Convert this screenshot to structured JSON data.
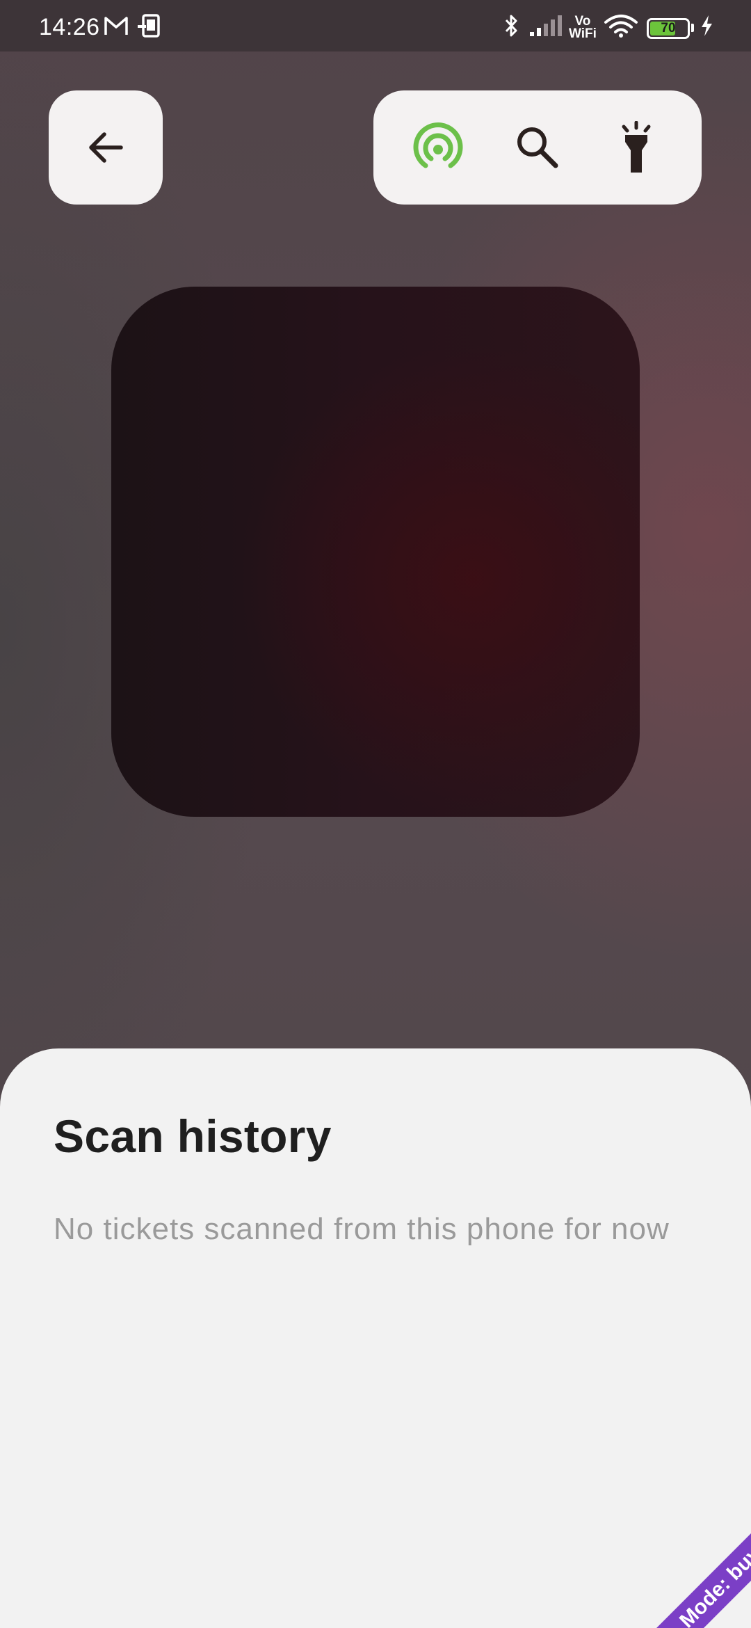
{
  "status_bar": {
    "time": "14:26",
    "vowifi_top": "Vo",
    "vowifi_bottom": "WiFi",
    "battery_percent": "70",
    "battery_level": 0.7,
    "icons": [
      "gmail-icon",
      "device-icon",
      "bluetooth-icon",
      "signal-icon",
      "vowifi-icon",
      "wifi-icon",
      "battery-icon",
      "charging-icon"
    ]
  },
  "toolbar": {
    "back_icon": "arrow-left-icon",
    "actions": [
      {
        "name": "nfc-icon",
        "color": "#6cc04a"
      },
      {
        "name": "search-icon",
        "color": "#2a201e"
      },
      {
        "name": "flashlight-icon",
        "color": "#2a201e"
      }
    ]
  },
  "sheet": {
    "title": "Scan history",
    "empty_message": "No tickets scanned from this phone for now"
  },
  "mode_ribbon": {
    "label": "Mode: buy",
    "color": "#7b3fc6"
  }
}
